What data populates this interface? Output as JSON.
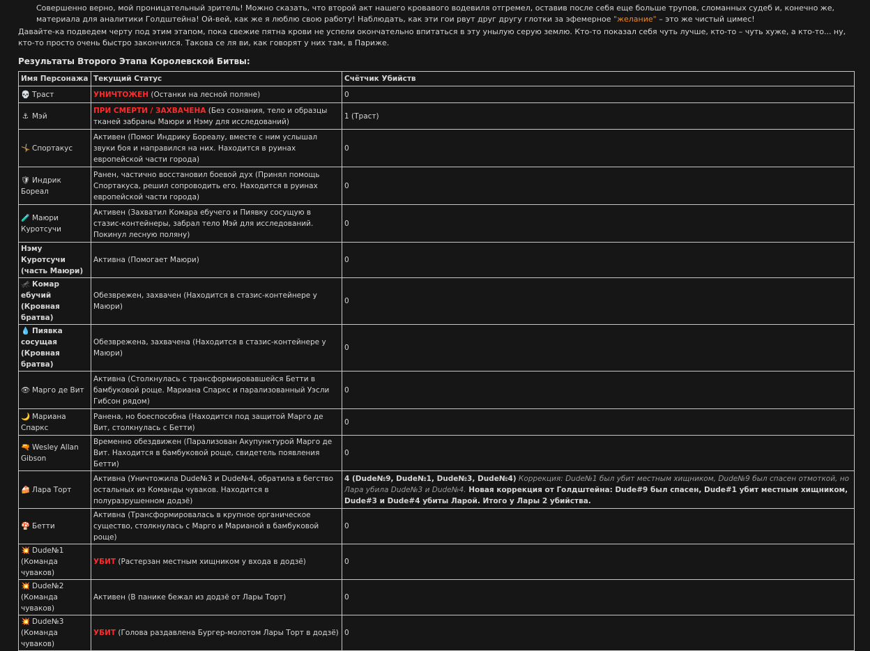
{
  "intro": {
    "p1_a": "Совершенно верно, мой проницательный зритель! Можно сказать, что второй акт нашего кровавого водевиля отгремел, оставив после себя еще больше трупов, сломанных судеб и, конечно же, материала для аналитики Голдштейна! Ой-вей, как же я люблю свою работу! Наблюдать, как эти гои рвут друг другу глотки за эфемерное ",
    "p1_accent": "\"желание\"",
    "p1_b": " – это же чистый цимес!",
    "p2": "Давайте-ка подведем черту под этим этапом, пока свежие пятна крови не успели окончательно впитаться в эту унылую серую землю. Кто-то показал себя чуть лучше, кто-то – чуть хуже, а кто-то... ну, кто-то просто очень быстро закончился. Такова се ля ви, как говорят у них там, в Париже."
  },
  "heading": "Результаты Второго Этапа Королевской Битвы:",
  "table": {
    "headers": [
      "Имя Персонажа",
      "Текущий Статус",
      "Счётчик Убийств"
    ],
    "rows": [
      {
        "icon": "💀",
        "icon_name": "skull-icon",
        "name": "Траст",
        "bold": false,
        "status_red": "УНИЧТОЖЕН",
        "status": " (Останки на лесной поляне)",
        "kills": "0",
        "h": 24
      },
      {
        "icon": "⚓",
        "icon_name": "anchor-icon",
        "name": "Мэй",
        "bold": false,
        "status_red": "ПРИ СМЕРТИ / ЗАХВАЧЕНА",
        "status": " (Без сознания, тело и образцы тканей забраны Маюри и Нэму для исследований)",
        "kills": "1 (Траст)",
        "h": 38
      },
      {
        "icon": "🤸",
        "icon_name": "acrobat-icon",
        "name": "Спортакус",
        "bold": false,
        "status_red": "",
        "status": "Активен (Помог Индрику Бореалу, вместе с ним услышал звуки боя и направился на них. Находится в руинах европейской части города)",
        "kills": "0",
        "h": 54
      },
      {
        "icon": "🛡",
        "icon_name": "shield-icon",
        "name": "Индрик Бореал",
        "bold": false,
        "status_red": "",
        "status": "Ранен, частично восстановил боевой дух (Принял помощь Спортакуса, решил сопроводить его. Находится в руинах европейской части города)",
        "kills": "0",
        "h": 54
      },
      {
        "icon": "🧪",
        "icon_name": "test-tube-icon",
        "name": "Маюри Куротсучи",
        "bold": false,
        "status_red": "",
        "status": "Активен (Захватил Комара ебучего и Пиявку сосущую в стазис-контейнеры, забрал тело Мэй для исследований. Покинул лесную поляну)",
        "kills": "0",
        "h": 54
      },
      {
        "icon": "",
        "icon_name": "",
        "name": "Нэму Куротсучи (часть Маюри)",
        "bold": true,
        "status_red": "",
        "status": "Активна (Помогает Маюри)",
        "kills": "0",
        "h": 36
      },
      {
        "icon": "🦟",
        "icon_name": "mosquito-icon",
        "name": "Комар ебучий (Кровная братва)",
        "bold": true,
        "status_red": "",
        "status": "Обезврежен, захвачен (Находится в стазис-контейнере у Маюри)",
        "kills": "0",
        "h": 38
      },
      {
        "icon": "💧",
        "icon_name": "droplet-icon",
        "name": "Пиявка сосущая (Кровная братва)",
        "bold": true,
        "status_red": "",
        "status": "Обезврежена, захвачена (Находится в стазис-контейнере у Маюри)",
        "kills": "0",
        "h": 54
      },
      {
        "icon": "👁",
        "icon_name": "eye-icon",
        "name": "Марго де Вит",
        "bold": false,
        "status_red": "",
        "status": "Активна (Столкнулась с трансформировавшейся Бетти в бамбуковой роще. Мариана Спаркс и парализованный Уэсли Гибсон рядом)",
        "kills": "0",
        "h": 54
      },
      {
        "icon": "🌙",
        "icon_name": "moon-icon",
        "name": "Мариана Спаркс",
        "bold": false,
        "status_red": "",
        "status": "Ранена, но боеспособна (Находится под защитой Марго де Вит, столкнулась с Бетти)",
        "kills": "0",
        "h": 38
      },
      {
        "icon": "🔫",
        "icon_name": "pistol-icon",
        "name": "Wesley Allan Gibson",
        "bold": false,
        "status_red": "",
        "status": "Временно обездвижен (Парализован Акупунктурой Марго де Вит. Находится в бамбуковой роще, свидетель появления Бетти)",
        "kills": "0",
        "h": 38
      },
      {
        "icon": "🍰",
        "icon_name": "cake-icon",
        "name": "Лара Торт",
        "bold": false,
        "status_red": "",
        "status": "Активна (Уничтожила Dude№3 и Dude№4, обратила в бегство остальных из Команды чуваков. Находится в полуразрушенном додзё)",
        "kills": "4 (Dude№9, Dude№1, Dude№3, Dude№4)",
        "kills_note": " Коррекция: Dude№1 был убит местным хищником, Dude№9 был спасен отмоткой, но Лара убила Dude№3 и Dude№4.",
        "kills_more": " Новая коррекция от Голдштейна: Dude#9 был спасен, Dude#1 убит местным хищником, Dude#3 и Dude#4 убиты Ларой. Итого у Лары 2 убийства.",
        "h": 54
      },
      {
        "icon": "🍄",
        "icon_name": "mushroom-icon",
        "name": "Бетти",
        "bold": false,
        "status_red": "",
        "status": "Активна (Трансформировалась в крупное органическое существо, столкнулась с Марго и Марианой в бамбуковой роще)",
        "kills": "0",
        "h": 38
      },
      {
        "icon": "💥",
        "icon_name": "explosion-icon",
        "name": "Dude№1 (Команда чуваков)",
        "bold": false,
        "status_red": "УБИТ",
        "status": " (Растерзан местным хищником у входа в додзё)",
        "kills": "0",
        "h": 38
      },
      {
        "icon": "💥",
        "icon_name": "explosion-icon",
        "name": "Dude№2 (Команда чуваков)",
        "bold": false,
        "status_red": "",
        "status": "Активен (В панике бежал из додзё от Лары Торт)",
        "kills": "0",
        "h": 38
      },
      {
        "icon": "💥",
        "icon_name": "explosion-icon",
        "name": "Dude№3 (Команда чуваков)",
        "bold": false,
        "status_red": "УБИТ",
        "status": " (Голова раздавлена Бургер-молотом Лары Торт в додзё)",
        "kills": "0",
        "h": 38
      }
    ]
  }
}
